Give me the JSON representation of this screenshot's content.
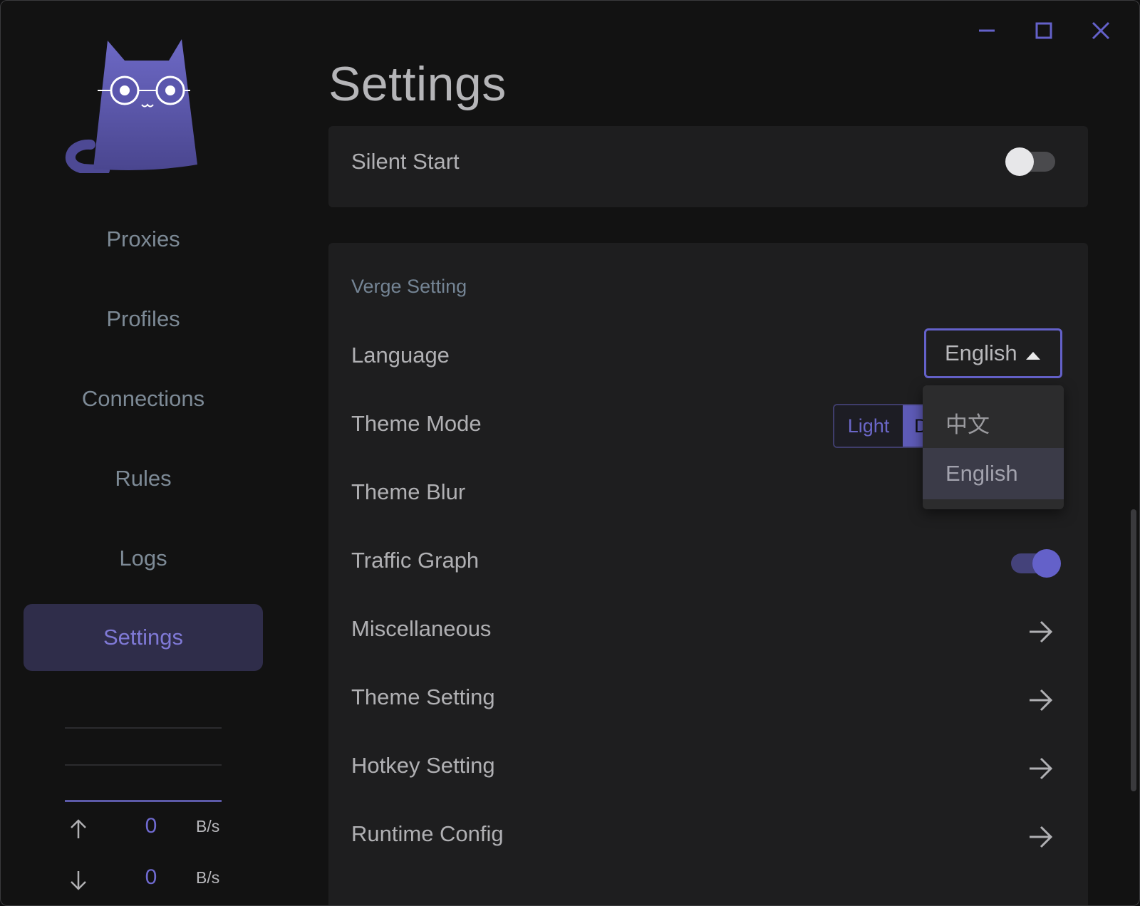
{
  "window": {
    "controls": [
      "minimize-icon",
      "maximize-icon",
      "close-icon"
    ],
    "accent": "#6461c9"
  },
  "sidebar": {
    "logo": "cat-logo-icon",
    "items": [
      {
        "label": "Proxies"
      },
      {
        "label": "Profiles"
      },
      {
        "label": "Connections"
      },
      {
        "label": "Rules"
      },
      {
        "label": "Logs"
      },
      {
        "label": "Settings",
        "active": true
      }
    ],
    "traffic": {
      "up": {
        "icon": "arrow-up-icon",
        "value": "0",
        "unit": "B/s"
      },
      "down": {
        "icon": "arrow-down-icon",
        "value": "0",
        "unit": "B/s"
      }
    }
  },
  "page": {
    "title": "Settings"
  },
  "system_card": {
    "silent_start": {
      "label": "Silent Start",
      "enabled": false
    }
  },
  "verge": {
    "section_title": "Verge Setting",
    "language": {
      "label": "Language",
      "value": "English",
      "options": [
        "中文",
        "English"
      ],
      "selected": "English"
    },
    "theme_mode": {
      "label": "Theme Mode",
      "options": [
        "Light",
        "D"
      ],
      "selected": "Dark"
    },
    "theme_blur": {
      "label": "Theme Blur"
    },
    "traffic_graph": {
      "label": "Traffic Graph",
      "enabled": true
    },
    "miscellaneous": {
      "label": "Miscellaneous"
    },
    "theme_setting": {
      "label": "Theme Setting"
    },
    "hotkey_setting": {
      "label": "Hotkey Setting"
    },
    "runtime_config": {
      "label": "Runtime Config"
    }
  }
}
